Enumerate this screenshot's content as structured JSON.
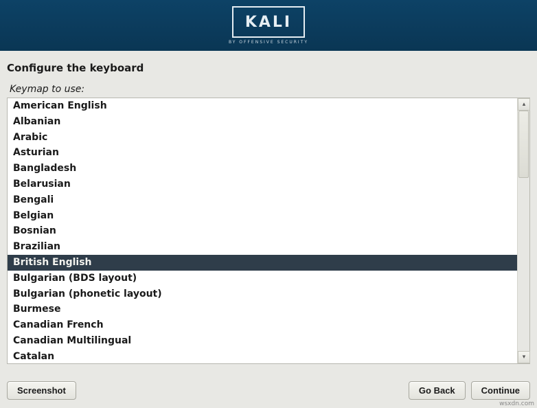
{
  "banner": {
    "brand": "KALI",
    "tagline": "BY OFFENSIVE SECURITY"
  },
  "title": "Configure the keyboard",
  "field_label": "Keymap to use:",
  "keymaps": [
    {
      "label": "American English",
      "selected": false
    },
    {
      "label": "Albanian",
      "selected": false
    },
    {
      "label": "Arabic",
      "selected": false
    },
    {
      "label": "Asturian",
      "selected": false
    },
    {
      "label": "Bangladesh",
      "selected": false
    },
    {
      "label": "Belarusian",
      "selected": false
    },
    {
      "label": "Bengali",
      "selected": false
    },
    {
      "label": "Belgian",
      "selected": false
    },
    {
      "label": "Bosnian",
      "selected": false
    },
    {
      "label": "Brazilian",
      "selected": false
    },
    {
      "label": "British English",
      "selected": true
    },
    {
      "label": "Bulgarian (BDS layout)",
      "selected": false
    },
    {
      "label": "Bulgarian (phonetic layout)",
      "selected": false
    },
    {
      "label": "Burmese",
      "selected": false
    },
    {
      "label": "Canadian French",
      "selected": false
    },
    {
      "label": "Canadian Multilingual",
      "selected": false
    },
    {
      "label": "Catalan",
      "selected": false
    }
  ],
  "buttons": {
    "screenshot": "Screenshot",
    "go_back": "Go Back",
    "continue": "Continue"
  },
  "watermark": "wsxdn.com"
}
